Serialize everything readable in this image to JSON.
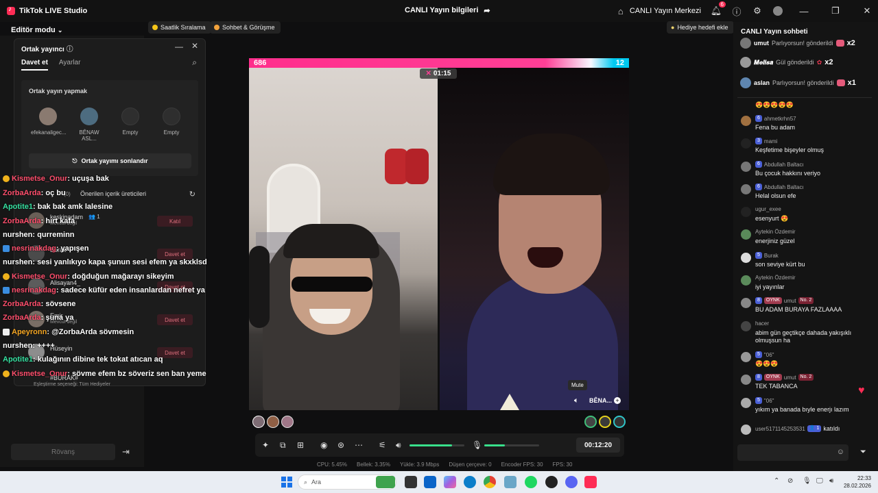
{
  "app": {
    "name": "TikTok LIVE Studio"
  },
  "titlebar": {
    "center_title": "CANLI Yayın bilgileri",
    "center_icon": "share-icon",
    "live_center_label": "CANLI Yayın Merkezi",
    "notification_count": "6"
  },
  "toolbar": {
    "editor_mode": "Editör modu",
    "pill_hourly": "Saatlik Sıralama",
    "pill_chat": "Sohbet & Görüşme",
    "gift_goal": "Hediye hedefi ekle"
  },
  "copublisher": {
    "title": "Ortak yayıncı",
    "tab_invite": "Davet et",
    "tab_settings": "Ayarlar",
    "section_title": "Ortak yayın yapmak",
    "slots": [
      "efekanaligec...",
      "BÊNAW ASL...",
      "Empty",
      "Empty"
    ],
    "end_button": "Ortak yayımı sonlandır",
    "suggested_label": "Önerilen içerik üreticileri",
    "suggested_count": "0",
    "invitees": [
      {
        "name": "keskinadam",
        "sub": "Mevcut değil",
        "badge": "1",
        "button": "Katıl"
      },
      {
        "name": "Burak",
        "sub": "",
        "button": "Davet et"
      },
      {
        "name": "Alisayan4_",
        "sub": "",
        "button": "Davet et"
      },
      {
        "name": "Emir",
        "sub": "Mevcut değil",
        "button": "Davet et"
      },
      {
        "name": "Hüseyin",
        "sub": "",
        "button": "Davet et"
      },
      {
        "name": "#BURAK#",
        "sub": "",
        "button": ""
      }
    ],
    "footer_hint": "Eşleştirme seçeneği: Tüm Hediyeler",
    "rematch_button": "Rövanş"
  },
  "overlay_chat": [
    {
      "user": "Kismetse_Onur",
      "text": ": uçuşa bak",
      "color": "#ff4f6d",
      "badge": "warn"
    },
    {
      "user": "ZorbaArda",
      "text": ": oç bu",
      "color": "#ff4f6d",
      "badge": ""
    },
    {
      "user": "Apotite1",
      "text": ": bak bak amk lalesine",
      "color": "#35e0a0",
      "badge": ""
    },
    {
      "user": "ZorbaArda",
      "text": ": hırt kafa",
      "color": "#ff4f6d",
      "badge": ""
    },
    {
      "user": "nurshen",
      "text": ": qurreminn",
      "color": "#ffffff",
      "badge": ""
    },
    {
      "user": "nesrinakdag",
      "text": ": yapışen",
      "color": "#ff4f6d",
      "badge": "blue"
    },
    {
      "user": "nurshen",
      "text": ": sesi yanlıkıyo kapa şunun sesi efem ya skxklsd",
      "color": "#ffffff",
      "badge": ""
    },
    {
      "user": "Kismetse_Onur",
      "text": ": doğduğun mağarayı sikeyim",
      "color": "#ff4f6d",
      "badge": "warn"
    },
    {
      "user": "nesrinakdag",
      "text": ": sadece küfür eden insanlardan nefret ya",
      "color": "#ff4f6d",
      "badge": "blue"
    },
    {
      "user": "ZorbaArda",
      "text": ": sövsene",
      "color": "#ff4f6d",
      "badge": ""
    },
    {
      "user": "ZorbaArda",
      "text": ": şuna ya",
      "color": "#ff4f6d",
      "badge": ""
    },
    {
      "user": "Apeyronn",
      "text": ": @ZorbaArda sövmesin",
      "color": "#f5a623",
      "badge": "white"
    },
    {
      "user": "nurshen",
      "text": ": ++++",
      "color": "#ffffff",
      "badge": ""
    },
    {
      "user": "Apotite1",
      "text": ": kulağının dibine tek tokat atıcan aq",
      "color": "#35e0a0",
      "badge": ""
    },
    {
      "user": "Kismetse_Onur",
      "text": ": sövme efem bz söveriz sen ban yeme",
      "color": "#ff4f6d",
      "badge": "warn"
    }
  ],
  "battle": {
    "score_left": "686",
    "score_right": "12",
    "timer": "01:15",
    "mute_tooltip": "Mute",
    "guest_name": "BÊNA..."
  },
  "controls": {
    "volume_level": 0.78,
    "mic_level": 0.38,
    "live_time": "00:12:20"
  },
  "stats": {
    "cpu": "CPU: 5.45%",
    "memory": "Bellek: 3.35%",
    "upload": "Yükle: 3.9 Mbps",
    "dropped": "Düşen çerçeve: 0",
    "encoder": "Encoder FPS: 30",
    "fps": "FPS: 30"
  },
  "right_chat": {
    "title": "CANLI Yayın sohbeti",
    "gifts": [
      {
        "user": "umut",
        "action": "Parlıyorsun! gönderildi",
        "mult": "x2"
      },
      {
        "user": "𝑴𝒆𝒍𝒊𝒔𝒂",
        "action": "Gül gönderildi",
        "mult": "x2"
      },
      {
        "user": "aslan",
        "action": "Parlıyorsun! gönderildi",
        "mult": "x1"
      }
    ],
    "messages": [
      {
        "user": "",
        "level": "",
        "text": "😍😍😍😍😍"
      },
      {
        "user": "ahmetkrhn57",
        "level": "6",
        "text": "Fena bu adam"
      },
      {
        "user": "mami",
        "level": "3",
        "text": "Keşfetime bişeyler olmuş"
      },
      {
        "user": "Abdullah Baltacı",
        "level": "6",
        "text": "Bu çocuk hakkını veriyo"
      },
      {
        "user": "Abdullah Baltacı",
        "level": "6",
        "text": "Helal olsun efe"
      },
      {
        "user": "ugur_exee",
        "level": "",
        "text": "esenyurt 😍"
      },
      {
        "user": "Aytekin Özdemir",
        "level": "",
        "text": "enerjiniz güzel"
      },
      {
        "user": "Burak",
        "level": "5",
        "text": "son seviye kürt bu"
      },
      {
        "user": "Aytekin Özdemir",
        "level": "",
        "text": "iyi yayınlar"
      },
      {
        "user": "umut",
        "level": "8",
        "fan": "OYNK",
        "rank": "No. 2",
        "text": "BU ADAM BURAYA FAZLAAAA"
      },
      {
        "user": "hacer",
        "level": "",
        "text": "abim gün geçtikçe dahada yakışıklı olmuşsun ha"
      },
      {
        "user": "\"06\"",
        "level": "5",
        "text": "😍😍😍"
      },
      {
        "user": "umut",
        "level": "8",
        "fan": "OYNK",
        "rank": "No. 2",
        "text": "TEK TABANCA"
      },
      {
        "user": "\"06\"",
        "level": "5",
        "text": "yıkım ya banada bıyle enerjı lazım"
      }
    ],
    "join": {
      "user": "user5171145253531",
      "level": "1",
      "text": "katıldı"
    }
  },
  "taskbar": {
    "search_placeholder": "Ara",
    "time": "22:33",
    "date": "28.02.2026"
  },
  "colors": {
    "accent": "#fe2c55",
    "score_left": "#ff2e8c",
    "score_right": "#00c9f0",
    "progress": "#38e08b"
  }
}
